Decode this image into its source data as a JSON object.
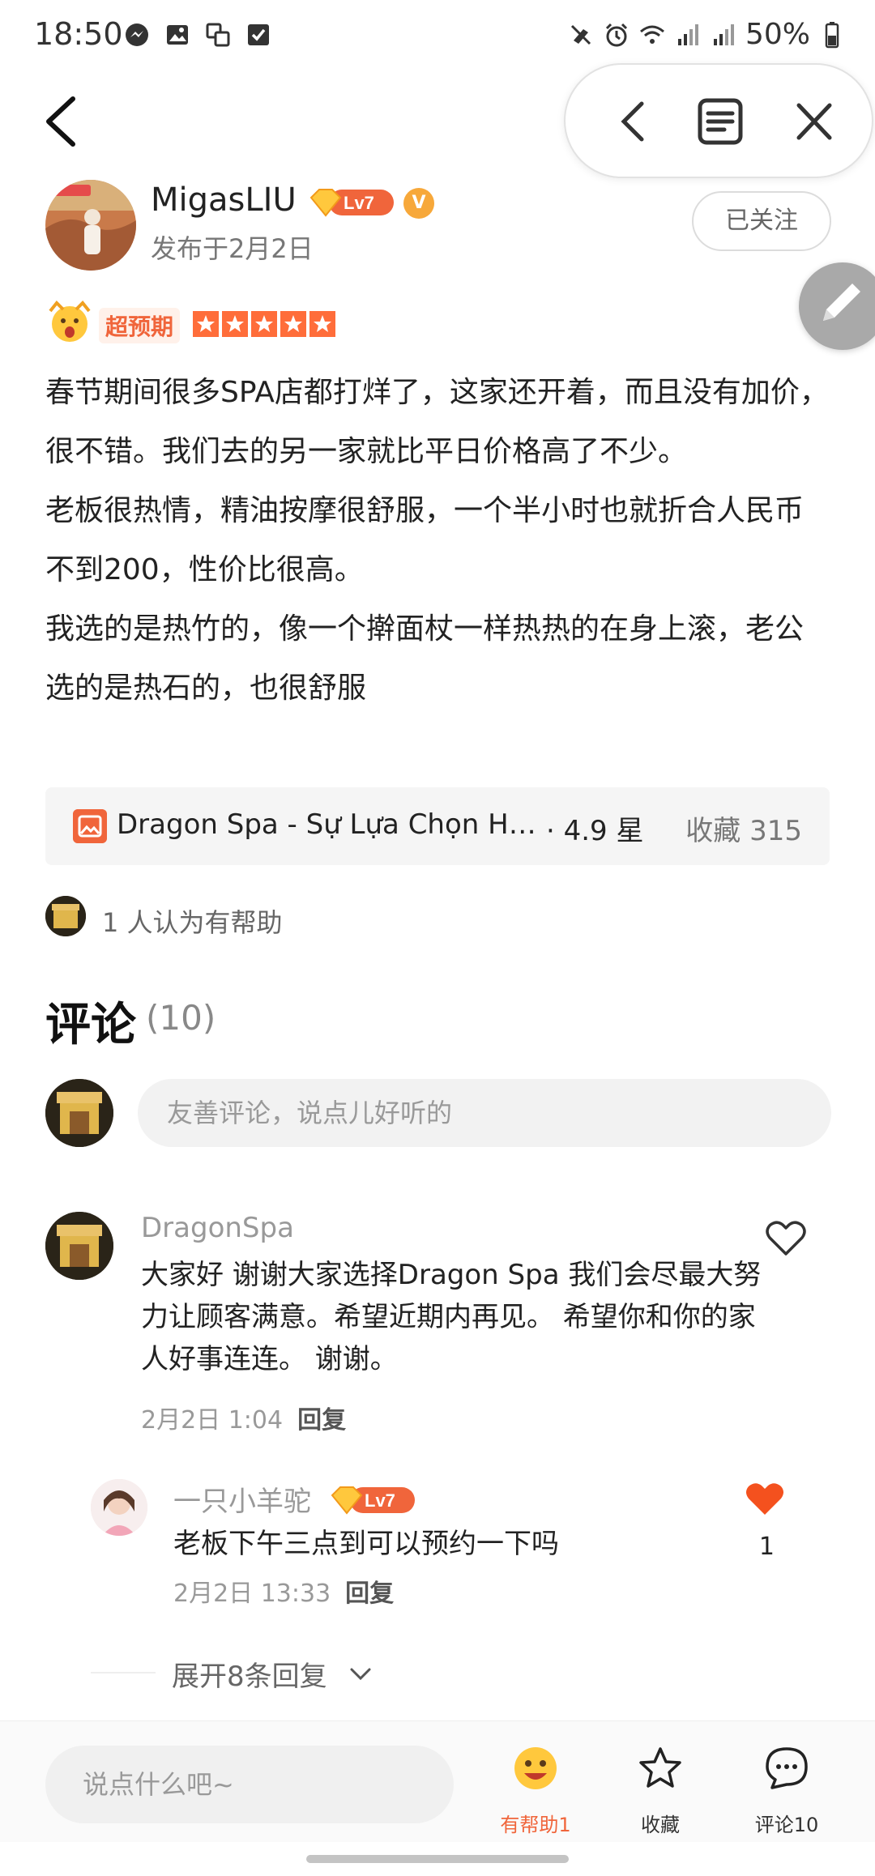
{
  "status_bar": {
    "time": "18:50",
    "battery": "50%",
    "icons_left": [
      "messenger-icon",
      "gallery-icon",
      "translate-icon",
      "checkbox-icon"
    ],
    "icons_right": [
      "no-sound-icon",
      "alarm-icon",
      "wifi-icon",
      "signal-icon",
      "signal-icon",
      "battery-icon"
    ]
  },
  "author": {
    "name": "MigasLIU",
    "level": "Lv7",
    "verified": "V",
    "post_date": "发布于2月2日",
    "follow_label": "已关注"
  },
  "rating": {
    "tag": "超预期",
    "stars": 5
  },
  "post": {
    "paragraphs": [
      "春节期间很多SPA店都打烊了，这家还开着，而且没有加价，很不错。我们去的另一家就比平日价格高了不少。",
      "老板很热情，精油按摩很舒服，一个半小时也就折合人民币不到200，性价比很高。",
      "我选的是热竹的，像一个擀面杖一样热热的在身上滚，老公选的是热石的，也很舒服"
    ]
  },
  "poi": {
    "name": "Dragon Spa - Sự Lựa Chọn Ho...",
    "rating": "· 4.9 星",
    "favorites": "收藏 315"
  },
  "helpful": {
    "text": "1 人认为有帮助"
  },
  "comments_section": {
    "title": "评论",
    "count": "(10)",
    "input_placeholder": "友善评论，说点儿好听的"
  },
  "comments": [
    {
      "name": "DragonSpa",
      "text": "大家好 谢谢大家选择Dragon Spa 我们会尽最大努力让顾客满意。希望近期内再见。 希望你和你的家人好事连连。 谢谢。",
      "date": "2月2日  1:04",
      "reply_label": "回复"
    }
  ],
  "reply": {
    "name": "一只小羊驼",
    "level": "Lv7",
    "text": "老板下午三点到可以预约一下吗",
    "date": "2月2日  13:33",
    "reply_label": "回复",
    "likes": "1"
  },
  "expand": {
    "label": "展开8条回复"
  },
  "bottom_bar": {
    "input_placeholder": "说点什么吧~",
    "helpful_label": "有帮助1",
    "favorite_label": "收藏",
    "comment_label": "评论10"
  },
  "colors": {
    "accent": "#f0653b",
    "like_red": "#f4511e",
    "gold": "#f7a83a"
  }
}
